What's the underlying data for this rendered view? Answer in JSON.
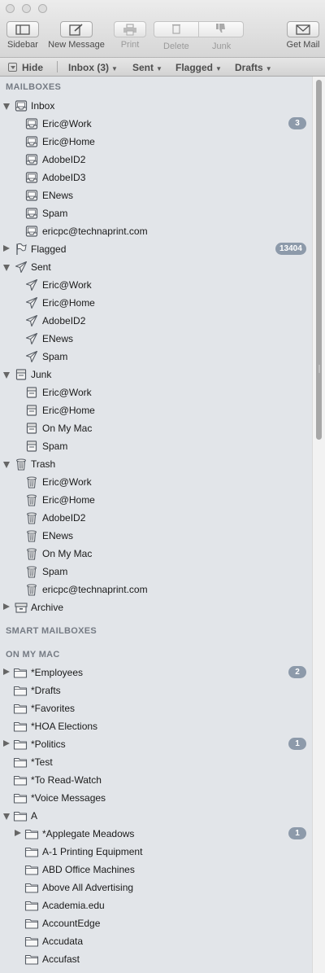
{
  "toolbar": {
    "sidebar": "Sidebar",
    "new_message": "New Message",
    "print": "Print",
    "delete": "Delete",
    "junk": "Junk",
    "get_mail": "Get Mail"
  },
  "favorites": {
    "hide": "Hide",
    "inbox": "Inbox (3)",
    "sent": "Sent",
    "flagged": "Flagged",
    "drafts": "Drafts"
  },
  "sections": {
    "mailboxes": "MAILBOXES",
    "smart_mailboxes": "SMART MAILBOXES",
    "on_my_mac": "ON MY MAC"
  },
  "mailbox_rows": [
    {
      "label": "Inbox",
      "level": 0,
      "icon": "inbox-icon",
      "disclosure": "open"
    },
    {
      "label": "Eric@Work",
      "level": 1,
      "icon": "inbox-icon",
      "badge": "3"
    },
    {
      "label": "Eric@Home",
      "level": 1,
      "icon": "inbox-icon"
    },
    {
      "label": "AdobeID2",
      "level": 1,
      "icon": "inbox-icon"
    },
    {
      "label": "AdobeID3",
      "level": 1,
      "icon": "inbox-icon"
    },
    {
      "label": "ENews",
      "level": 1,
      "icon": "inbox-icon"
    },
    {
      "label": "Spam",
      "level": 1,
      "icon": "inbox-icon"
    },
    {
      "label": "ericpc@technaprint.com",
      "level": 1,
      "icon": "inbox-icon"
    },
    {
      "label": "Flagged",
      "level": 0,
      "icon": "flag-icon",
      "disclosure": "closed",
      "badge": "13404"
    },
    {
      "label": "Sent",
      "level": 0,
      "icon": "sent-icon",
      "disclosure": "open"
    },
    {
      "label": "Eric@Work",
      "level": 1,
      "icon": "sent-icon"
    },
    {
      "label": "Eric@Home",
      "level": 1,
      "icon": "sent-icon"
    },
    {
      "label": "AdobeID2",
      "level": 1,
      "icon": "sent-icon"
    },
    {
      "label": "ENews",
      "level": 1,
      "icon": "sent-icon"
    },
    {
      "label": "Spam",
      "level": 1,
      "icon": "sent-icon"
    },
    {
      "label": "Junk",
      "level": 0,
      "icon": "junk-icon",
      "disclosure": "open"
    },
    {
      "label": "Eric@Work",
      "level": 1,
      "icon": "junk-icon"
    },
    {
      "label": "Eric@Home",
      "level": 1,
      "icon": "junk-icon"
    },
    {
      "label": "On My Mac",
      "level": 1,
      "icon": "junk-icon"
    },
    {
      "label": "Spam",
      "level": 1,
      "icon": "junk-icon"
    },
    {
      "label": "Trash",
      "level": 0,
      "icon": "trash-icon",
      "disclosure": "open"
    },
    {
      "label": "Eric@Work",
      "level": 1,
      "icon": "trash-icon"
    },
    {
      "label": "Eric@Home",
      "level": 1,
      "icon": "trash-icon"
    },
    {
      "label": "AdobeID2",
      "level": 1,
      "icon": "trash-icon"
    },
    {
      "label": "ENews",
      "level": 1,
      "icon": "trash-icon"
    },
    {
      "label": "On My Mac",
      "level": 1,
      "icon": "trash-icon"
    },
    {
      "label": "Spam",
      "level": 1,
      "icon": "trash-icon"
    },
    {
      "label": "ericpc@technaprint.com",
      "level": 1,
      "icon": "trash-icon"
    },
    {
      "label": "Archive",
      "level": 0,
      "icon": "archive-icon",
      "disclosure": "closed"
    }
  ],
  "local_rows": [
    {
      "label": " *Employees",
      "level": 0,
      "icon": "folder-icon",
      "disclosure": "closed",
      "badge": "2"
    },
    {
      "label": "*Drafts",
      "level": 0,
      "icon": "folder-icon"
    },
    {
      "label": "*Favorites",
      "level": 0,
      "icon": "folder-icon"
    },
    {
      "label": "*HOA Elections",
      "level": 0,
      "icon": "folder-icon"
    },
    {
      "label": "*Politics",
      "level": 0,
      "icon": "folder-icon",
      "disclosure": "closed",
      "badge": "1"
    },
    {
      "label": "*Test",
      "level": 0,
      "icon": "folder-icon"
    },
    {
      "label": "*To Read-Watch",
      "level": 0,
      "icon": "folder-icon"
    },
    {
      "label": "*Voice Messages",
      "level": 0,
      "icon": "folder-icon"
    },
    {
      "label": "A",
      "level": 0,
      "icon": "folder-icon",
      "disclosure": "open"
    },
    {
      "label": "*Applegate Meadows",
      "level": 1,
      "icon": "folder-icon",
      "disclosure": "closed",
      "badge": "1"
    },
    {
      "label": "A-1 Printing Equipment",
      "level": 1,
      "icon": "folder-icon"
    },
    {
      "label": "ABD Office Machines",
      "level": 1,
      "icon": "folder-icon"
    },
    {
      "label": "Above All Advertising",
      "level": 1,
      "icon": "folder-icon"
    },
    {
      "label": "Academia.edu",
      "level": 1,
      "icon": "folder-icon"
    },
    {
      "label": "AccountEdge",
      "level": 1,
      "icon": "folder-icon"
    },
    {
      "label": "Accudata",
      "level": 1,
      "icon": "folder-icon"
    },
    {
      "label": "Accufast",
      "level": 1,
      "icon": "folder-icon"
    },
    {
      "label": "",
      "level": 1,
      "icon": "folder-icon"
    }
  ],
  "colors": {
    "sidebar_bg": "#e2e5e9",
    "badge_bg": "#8d9aaa",
    "icon_stroke": "#555b63"
  }
}
